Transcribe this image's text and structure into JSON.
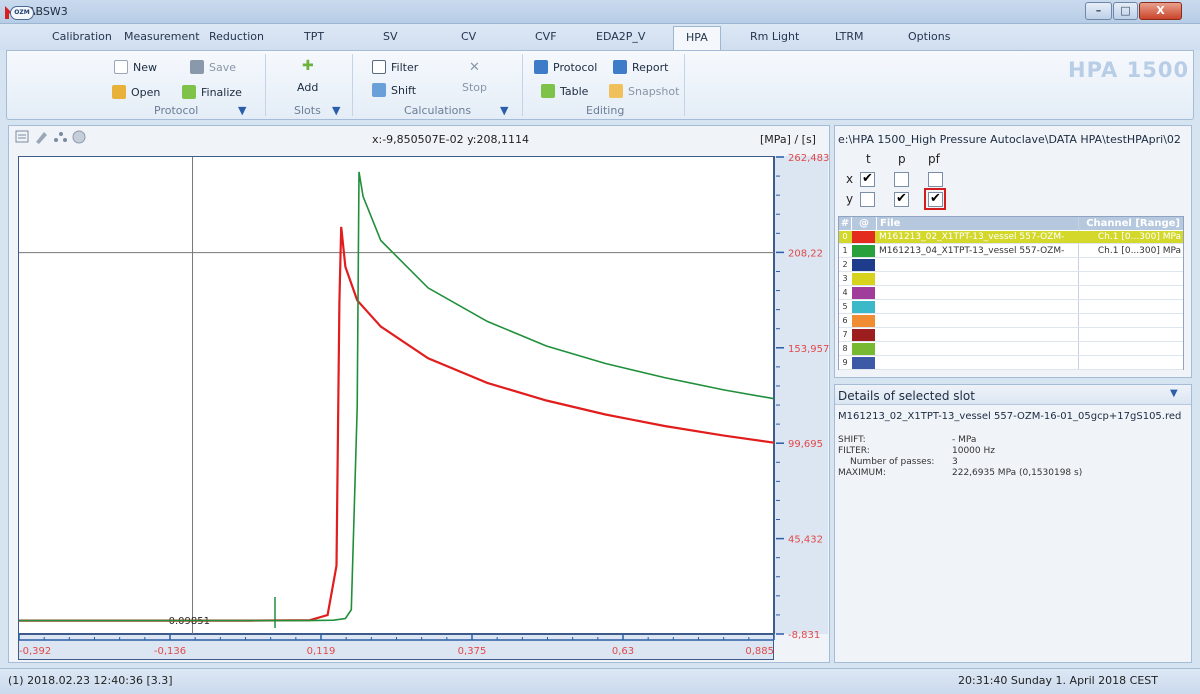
{
  "window": {
    "title": "ABSW3",
    "controls": {
      "minimize": "–",
      "maximize": "□",
      "close": "X"
    }
  },
  "menu": {
    "logo": "OZM",
    "tabs": [
      {
        "label": "Calibration"
      },
      {
        "label": "Measurement"
      },
      {
        "label": "Reduction"
      },
      {
        "label": "TPT"
      },
      {
        "label": "SV"
      },
      {
        "label": "CV"
      },
      {
        "label": "CVF"
      },
      {
        "label": "EDA2P_V"
      },
      {
        "label": "HPA",
        "active": true
      },
      {
        "label": "Rm Light"
      },
      {
        "label": "LTRM"
      },
      {
        "label": "Options"
      }
    ]
  },
  "ribbon": {
    "protocol": {
      "new": "New",
      "save": "Save",
      "open": "Open",
      "finalize": "Finalize",
      "label": "Protocol"
    },
    "slots": {
      "add": "Add",
      "label": "Slots"
    },
    "calculations": {
      "filter": "Filter",
      "stop": "Stop",
      "shift": "Shift",
      "label": "Calculations"
    },
    "editing": {
      "protocol": "Protocol",
      "report": "Report",
      "table": "Table",
      "snapshot": "Snapshot",
      "label": "Editing"
    },
    "brand": "HPA 1500"
  },
  "chart": {
    "coord_readout": "x:-9,850507E-02 y:208,1114",
    "unit_label": "[MPa] / [s]",
    "cursor_value_label": "-0.09851"
  },
  "chart_data": {
    "type": "line",
    "title": "",
    "xlabel": "",
    "ylabel": "",
    "xlim": [
      -0.392,
      0.885
    ],
    "ylim": [
      -8.831,
      262.483
    ],
    "xticks": [
      "-0,392",
      "-0,136",
      "0,119",
      "0,375",
      "0,63",
      "0,885"
    ],
    "yticks": [
      "262,483",
      "208,22",
      "153,957",
      "99,695",
      "45,432",
      "-8,831"
    ],
    "cursor": {
      "x": -0.0985,
      "y": 208.11
    },
    "marker_x": -0.0985,
    "series": [
      {
        "color": "#e11d1d",
        "x": [
          -0.392,
          0.0,
          0.1,
          0.13,
          0.145,
          0.15,
          0.153,
          0.16,
          0.18,
          0.22,
          0.3,
          0.4,
          0.5,
          0.6,
          0.7,
          0.8,
          0.885
        ],
        "y": [
          -1.2,
          -1.2,
          -1.0,
          2.0,
          30.0,
          180.0,
          222.7,
          200.0,
          181.0,
          166.0,
          148.0,
          134.0,
          124.0,
          116.0,
          109.5,
          104.0,
          100.0
        ]
      },
      {
        "color": "#1f8f3a",
        "x": [
          -0.392,
          0.0,
          0.1,
          0.14,
          0.16,
          0.17,
          0.18,
          0.183,
          0.19,
          0.22,
          0.3,
          0.4,
          0.5,
          0.6,
          0.7,
          0.8,
          0.885
        ],
        "y": [
          -1.2,
          -1.2,
          -1.2,
          -1.0,
          0.0,
          5.0,
          120.0,
          254.0,
          240.0,
          215.0,
          188.0,
          169.0,
          155.0,
          145.0,
          137.0,
          130.0,
          125.0
        ]
      }
    ]
  },
  "file_panel": {
    "path": "e:\\HPA 1500_High Pressure Autoclave\\DATA HPA\\testHPApri\\02",
    "axis_columns": [
      "t",
      "p",
      "pf"
    ],
    "axis_rows": [
      "x",
      "y"
    ],
    "checks": {
      "x_t": "✔",
      "x_p": "",
      "x_pf": "",
      "y_t": "",
      "y_p": "✔",
      "y_pf": "✔"
    },
    "table_headers": {
      "num": "#",
      "at": "@",
      "file": "File",
      "channel": "Channel [Range]"
    },
    "slots": [
      {
        "num": "0",
        "color": "#e32b1e",
        "file": "M161213_02_X1TPT-13_vessel 557-OZM-",
        "channel": "Ch.1 [0...300] MPa",
        "selected": true
      },
      {
        "num": "1",
        "color": "#28a03c",
        "file": "M161213_04_X1TPT-13_vessel 557-OZM-",
        "channel": "Ch.1 [0...300] MPa"
      },
      {
        "num": "2",
        "color": "#1e3c8c",
        "file": "",
        "channel": ""
      },
      {
        "num": "3",
        "color": "#d6d21e",
        "file": "",
        "channel": ""
      },
      {
        "num": "4",
        "color": "#a03c9a",
        "file": "",
        "channel": ""
      },
      {
        "num": "5",
        "color": "#3cb9c8",
        "file": "",
        "channel": ""
      },
      {
        "num": "6",
        "color": "#f08c32",
        "file": "",
        "channel": ""
      },
      {
        "num": "7",
        "color": "#9c1e1e",
        "file": "",
        "channel": ""
      },
      {
        "num": "8",
        "color": "#78b932",
        "file": "",
        "channel": ""
      },
      {
        "num": "9",
        "color": "#3c5aa5",
        "file": "",
        "channel": ""
      }
    ]
  },
  "details": {
    "title": "Details of selected slot",
    "filename": "M161213_02_X1TPT-13_vessel 557-OZM-16-01_05gcp+17gS105.red",
    "shift_label": "SHIFT:",
    "shift_value": "- MPa",
    "filter_label": "FILTER:",
    "filter_value": "10000 Hz",
    "passes_label": "Number of passes:",
    "passes_value": "3",
    "maximum_label": "MAXIMUM:",
    "maximum_value": "222,6935 MPa (0,1530198 s)"
  },
  "status": {
    "left": "(1) 2018.02.23 12:40:36 [3.3]",
    "right": "20:31:40 Sunday 1. April 2018 CEST"
  }
}
